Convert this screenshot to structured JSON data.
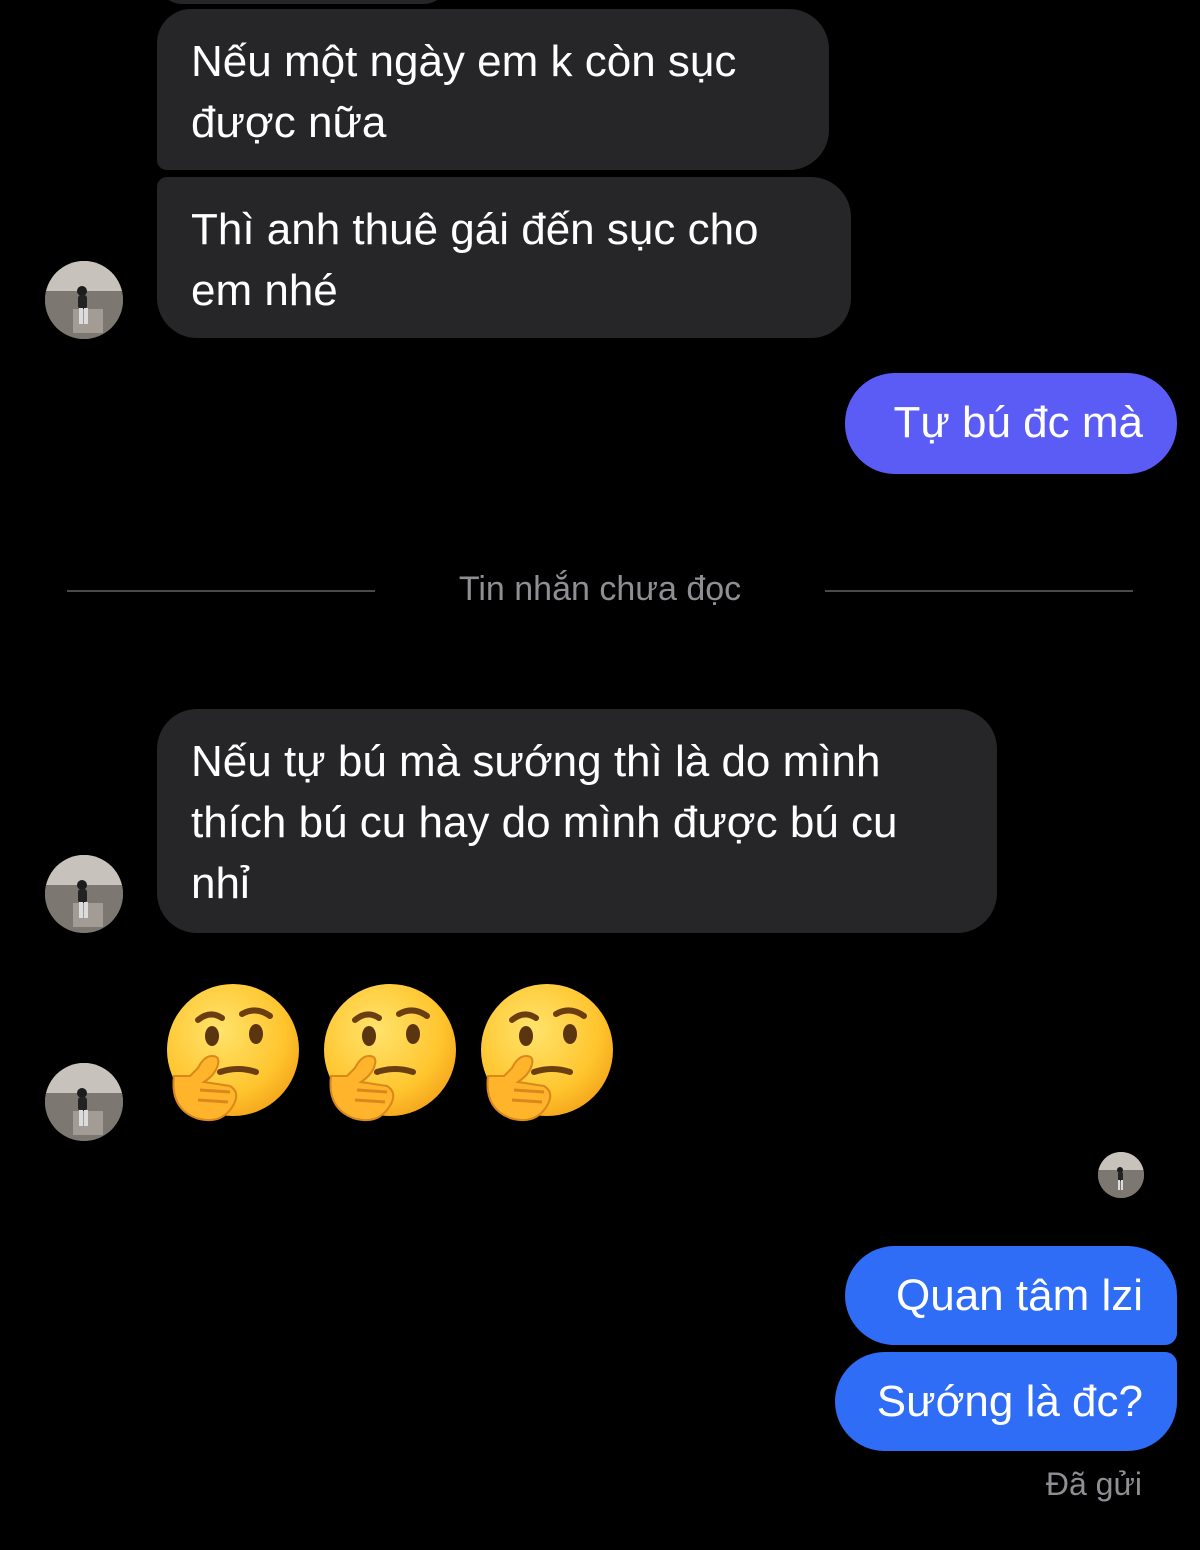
{
  "messages": {
    "m0": "Nếu một ngày em k còn sục được nữa",
    "m1": "Thì anh thuê gái đến sục cho em nhé",
    "m2": "Tự bú đc mà",
    "m3": "Nếu tự bú mà sướng thì là do mình thích bú cu hay do mình được bú cu nhỉ",
    "m4": "Quan tâm lzi",
    "m5": "Sướng là đc?"
  },
  "divider": {
    "label": "Tin nhắn chưa đọc"
  },
  "status": {
    "label": "Đã gửi"
  },
  "reaction": {
    "emoji": "🤔",
    "count": 3
  },
  "colors": {
    "background": "#000000",
    "incoming_bubble": "#262628",
    "outgoing_bubble_purple": "#5b5cf6",
    "outgoing_bubble_blue": "#2f6df6",
    "muted_text": "#8e8e93"
  },
  "icons": {
    "avatar": "contact-avatar-icon",
    "read_receipt": "read-receipt-avatar-icon",
    "emoji": "thinking-face-emoji"
  }
}
